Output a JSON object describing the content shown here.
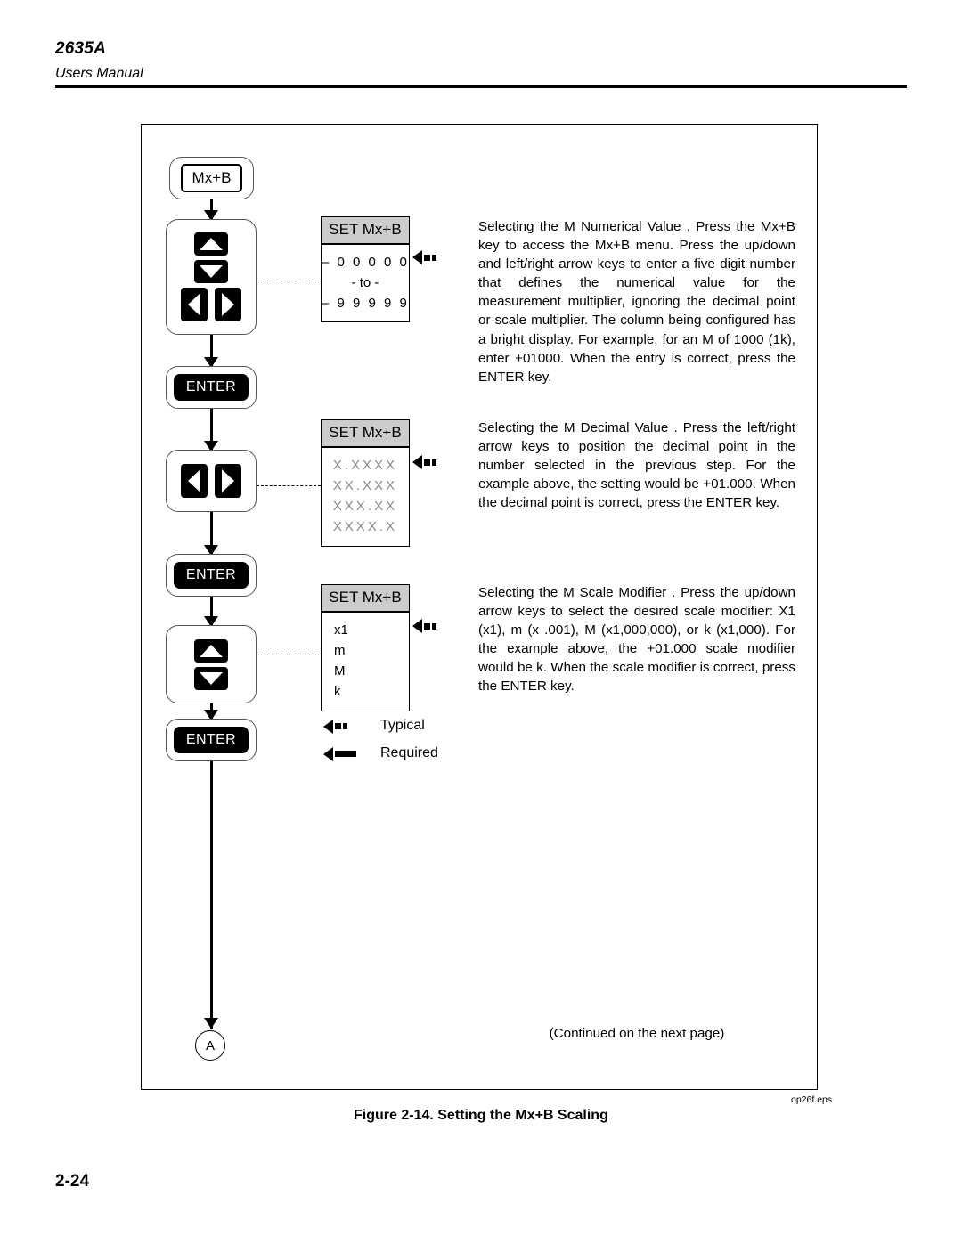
{
  "header": {
    "model": "2635A",
    "subtitle": "Users Manual"
  },
  "figure": {
    "caption": "Figure 2-14. Setting the Mx+B Scaling",
    "eps_ref": "op26f.eps",
    "connector_label": "A",
    "continued_note": "(Continued on the next page)"
  },
  "flow": {
    "key_mxb": "Mx+B",
    "key_enter": "ENTER",
    "arrow_up_icon": "arrow-up-icon",
    "arrow_down_icon": "arrow-down-icon",
    "arrow_left_icon": "arrow-left-icon",
    "arrow_right_icon": "arrow-right-icon"
  },
  "displays": {
    "numerical": {
      "title": "SET Mx+B",
      "lines": [
        "– 0 0 0 0 0",
        "- to -",
        "– 9 9 9 9 9"
      ]
    },
    "decimal": {
      "title": "SET Mx+B",
      "lines": [
        "X.XXXX",
        "XX.XXX",
        "XXX.XX",
        "XXXX.X"
      ]
    },
    "modifier": {
      "title": "SET Mx+B",
      "lines": [
        "x1",
        "m",
        "M",
        "k"
      ]
    }
  },
  "legend": {
    "typical_label": "Typical",
    "required_label": "Required"
  },
  "paragraphs": {
    "numerical": "Selecting the M Numerical Value .  Press the Mx+B key to access the Mx+B menu.  Press the up/down and left/right arrow keys to enter a five digit number that defines the numerical value for the measurement multiplier, ignoring the decimal point or scale multiplier.  The column being configured has a bright display.  For example, for an M of 1000 (1k), enter +01000.   When the entry is correct, press the ENTER key.",
    "decimal": "Selecting the M Decimal Value .  Press the left/right arrow keys to position the decimal point in the number selected in the previous step.  For the example above, the setting would be +01.000.  When the decimal point is correct, press the ENTER key.",
    "modifier": "Selecting the M Scale Modifier .  Press the up/down arrow keys to select the desired scale modifier: X1 (x1), m (x .001), M (x1,000,000), or k (x1,000).  For the example above, the +01.000 scale modifier would be k.  When the scale modifier is correct, press the ENTER key."
  },
  "footer": {
    "page_number": "2-24"
  }
}
